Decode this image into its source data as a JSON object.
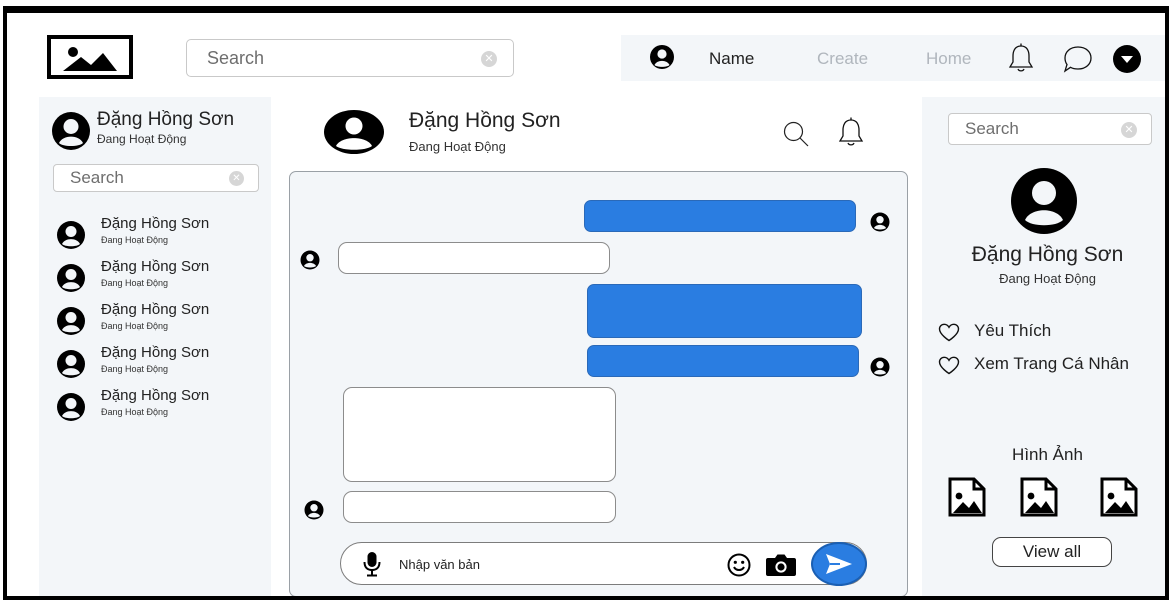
{
  "header": {
    "logo_icon": "image-icon",
    "search": {
      "placeholder": "Search",
      "value": ""
    },
    "nav": {
      "user_label": "Name",
      "create_label": "Create",
      "home_label": "Home",
      "icons": [
        "user-circle-icon",
        "bell-icon",
        "chat-bubble-icon",
        "chevron-down-icon"
      ]
    }
  },
  "sidebar": {
    "me": {
      "name": "Đặng Hồng Sơn",
      "status": "Đang Hoạt Động"
    },
    "search": {
      "placeholder": "Search",
      "value": ""
    },
    "contacts": [
      {
        "name": "Đặng Hồng Sơn",
        "status": "Đang Hoạt Động"
      },
      {
        "name": "Đặng Hồng Sơn",
        "status": "Đang Hoạt Động"
      },
      {
        "name": "Đặng Hồng Sơn",
        "status": "Đang Hoạt Động"
      },
      {
        "name": "Đặng Hồng Sơn",
        "status": "Đang Hoạt Động"
      },
      {
        "name": "Đặng Hồng Sơn",
        "status": "Đang Hoạt Động"
      }
    ]
  },
  "chat": {
    "header": {
      "name": "Đặng Hồng Sơn",
      "status": "Đang Hoạt Động"
    },
    "composer": {
      "placeholder": "Nhập văn bản",
      "value": ""
    },
    "colors": {
      "outgoing_bubble": "#2a7de1",
      "incoming_bubble": "#ffffff",
      "panel_bg": "#f3f6f9"
    }
  },
  "profile": {
    "search": {
      "placeholder": "Search",
      "value": ""
    },
    "name": "Đặng Hồng Sơn",
    "status": "Đang Hoạt Động",
    "links": [
      {
        "label": "Yêu Thích",
        "icon": "heart-icon"
      },
      {
        "label": "Xem Trang Cá Nhân",
        "icon": "heart-icon"
      }
    ],
    "images_title": "Hình Ảnh",
    "view_all_label": "View all"
  }
}
